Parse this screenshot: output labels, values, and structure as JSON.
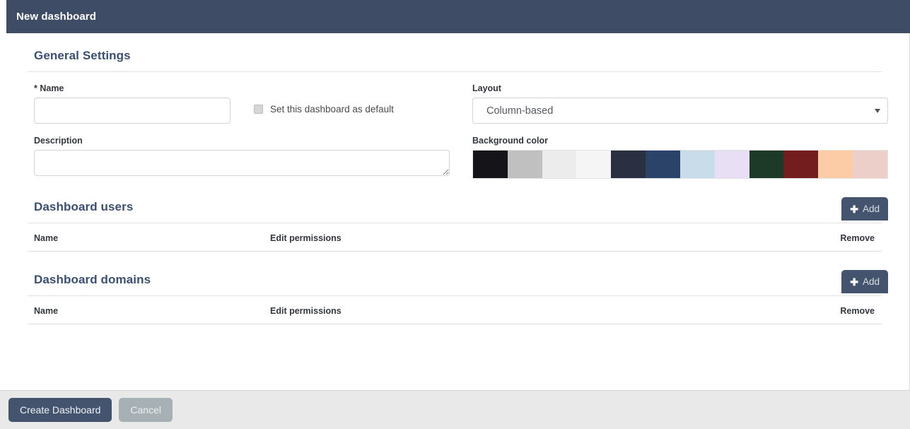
{
  "window": {
    "title": "New dashboard"
  },
  "general": {
    "heading": "General Settings",
    "name_label": "* Name",
    "name_value": "",
    "name_placeholder": "",
    "default_checkbox_label": "Set this dashboard as default",
    "default_checked": false,
    "description_label": "Description",
    "description_value": "",
    "description_placeholder": "",
    "layout_label": "Layout",
    "layout_selected": "Column-based",
    "layout_options": [
      "Column-based"
    ],
    "background_label": "Background color",
    "background_swatches": [
      "#141419",
      "#c0c0c0",
      "#ececec",
      "#f5f5f5",
      "#2a3042",
      "#2b4369",
      "#c9dcea",
      "#e8dff4",
      "#1d3a29",
      "#741d1e",
      "#fbcca6",
      "#eccfc8"
    ]
  },
  "users_section": {
    "heading": "Dashboard users",
    "add_label": "Add",
    "columns": [
      "Name",
      "Edit permissions",
      "Remove"
    ],
    "rows": []
  },
  "domains_section": {
    "heading": "Dashboard domains",
    "add_label": "Add",
    "columns": [
      "Name",
      "Edit permissions",
      "Remove"
    ],
    "rows": []
  },
  "footer": {
    "submit_label": "Create Dashboard",
    "cancel_label": "Cancel"
  },
  "theme": {
    "header_bg": "#3f4c66",
    "heading_color": "#3c4f6e",
    "primary_button": "#44546f",
    "muted_button": "#a7b0b4",
    "footer_bg": "#e9e9e9"
  }
}
